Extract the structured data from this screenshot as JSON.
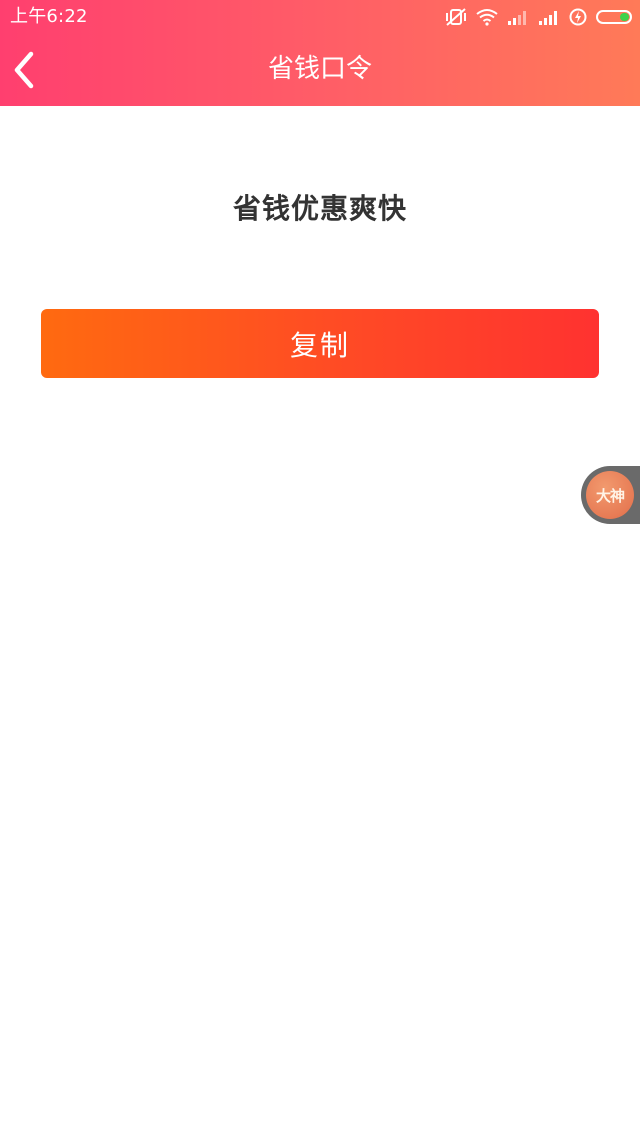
{
  "status_bar": {
    "time": "上午6:22",
    "icons": [
      "vibrate-mute-icon",
      "wifi-icon",
      "signal-icon",
      "signal-icon",
      "charging-icon",
      "battery-icon"
    ],
    "battery_color": "#3fd24a"
  },
  "header": {
    "back_icon": "chevron-left-icon",
    "title": "省钱口令",
    "gradient_colors": [
      "#ff3f6f",
      "#ff7a58"
    ]
  },
  "main": {
    "slogan": "省钱优惠爽快",
    "copy_button_label": "复制",
    "copy_button_colors": [
      "#ff6a10",
      "#ff3230"
    ]
  },
  "floating_widget": {
    "label": "大神"
  }
}
